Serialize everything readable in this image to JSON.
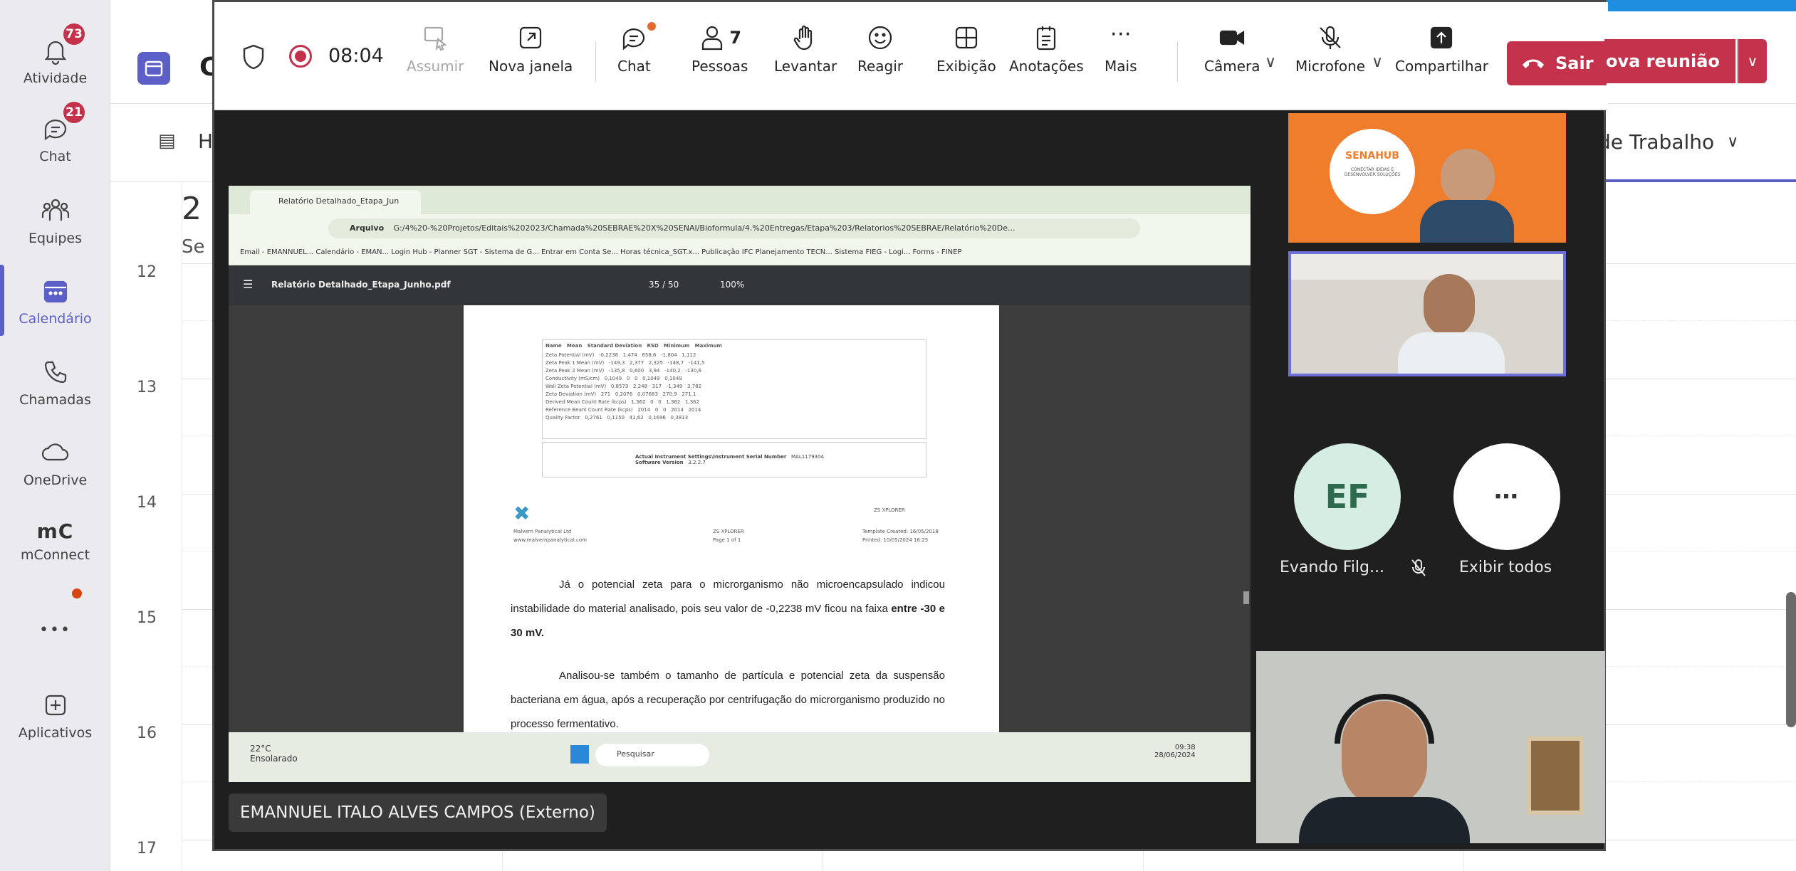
{
  "rail": {
    "items": [
      {
        "label": "Atividade",
        "badge": "73"
      },
      {
        "label": "Chat",
        "badge": "21"
      },
      {
        "label": "Equipes"
      },
      {
        "label": "Calendário"
      },
      {
        "label": "Chamadas"
      },
      {
        "label": "OneDrive"
      },
      {
        "label": "mConnect",
        "logo": "mC"
      },
      {
        "label": "•••"
      },
      {
        "label": "Aplicativos"
      }
    ]
  },
  "calendar": {
    "title_initial": "C",
    "today_initial": "H",
    "date_big_initial": "2",
    "date_sub_initial": "Se",
    "view_selector": "de Trabalho",
    "hours": [
      "12",
      "13",
      "14",
      "15",
      "16",
      "17"
    ]
  },
  "meeting": {
    "timer": "08:04",
    "toolbar": {
      "take_control": "Assumir",
      "new_window": "Nova janela",
      "chat": "Chat",
      "people": "Pessoas",
      "people_count": "7",
      "raise": "Levantar",
      "react": "Reagir",
      "view": "Exibição",
      "notes": "Anotações",
      "more": "Mais",
      "camera": "Câmera",
      "mic": "Microfone",
      "share": "Compartilhar",
      "leave": "Sair",
      "leave_hidden_text": "ova reunião"
    },
    "presenter": "EMANNUEL ITALO ALVES CAMPOS (Externo)",
    "participant_ef": {
      "initials": "EF",
      "name": "Evando Filg..."
    },
    "show_all": "Exibir todos"
  },
  "shared_screen": {
    "tab_title": "Relatório Detalhado_Etapa_Jun",
    "address": "G:/4%20-%20Projetos/Editais%202023/Chamada%20SEBRAE%20X%20SENAI/Bioformula/4.%20Entregas/Etapa%203/Relatorios%20SEBRAE/Relatório%20De...",
    "address_prefix": "Arquivo",
    "bookmarks": "Email - EMANNUEL...   Calendário - EMAN...   Login   Hub - Planner   SGT - Sistema de G...   Entrar em Conta Se...   Horas técnica_SGT.x...   Publicação IFC   Planejamento TECN...   Sistema FIEG - Logi...   Forms - FINEP",
    "pdf_title": "Relatório Detalhado_Etapa_Junho.pdf",
    "pdf_pages": "35 / 50",
    "pdf_zoom": "100%",
    "table_header": "Name   Mean   Standard Deviation   RSD   Minimum   Maximum",
    "table_rows": [
      "Zeta Potential (mV)   -0,2238   1,474   658,6   -1,804   1,112",
      "Zeta Peak 1 Mean (mV)   -149,3   2,377   2,325   -148,7   -141,5",
      "Zeta Peak 2 Mean (mV)   -135,8   0,600   3,94   -140,2   -130,6",
      "Conductivity (mS/cm)   0,1049   0   0   0,1049   0,1049",
      "Wall Zeta Potential (mV)   0,8573   2,248   317   -1,349   3,782",
      "Zeta Deviation (mV)   271   0,2076   0,07663   270,9   271,1",
      "Derived Mean Count Rate (kcps)   1,362   0   0   1,362   1,362",
      "Reference Beam Count Rate (kcps)   2014   0   0   2014   2014",
      "Quality Factor   0,2761   0,1150   41,62   0,1696   0,3813"
    ],
    "instrument_label": "Actual Instrument Settings\\Instrument Serial Number",
    "instrument_value": "MAL1179304",
    "software_label": "Software Version",
    "software_value": "3.2.2.7",
    "footer_company": "Malvern Panalytical Ltd",
    "footer_site": "www.malvernpanalytical.com",
    "footer_code": "ZS XPLORER",
    "footer_page": "Page 1 of 1",
    "footer_created": "Template Created: 16/05/2018",
    "footer_printed": "Printed: 10/05/2024 16:25",
    "footer_brand": "ZS XPLORER",
    "para1_a": "Já o potencial zeta para o microrganismo não microencapsulado indicou instabilidade do material analisado, pois seu valor de -0,2238 mV ficou na faixa ",
    "para1_b": "entre -30 e 30 mV.",
    "para2": "Analisou-se também o tamanho de partícula e potencial zeta da suspensão bacteriana em água, após a recuperação por centrifugação do microrganismo produzido no processo fermentativo.",
    "taskbar_temp": "22°C",
    "taskbar_weather": "Ensolarado",
    "taskbar_search": "Pesquisar",
    "taskbar_time": "09:38",
    "taskbar_date": "28/06/2024"
  },
  "tile1_text": {
    "brand": "SENAHUB",
    "tagline": "CONECTAR IDEIAS E DESENVOLVER SOLUÇÕES"
  },
  "colors": {
    "accent": "#5b5fc7",
    "leave": "#c4314b",
    "badge": "#c4314b"
  }
}
